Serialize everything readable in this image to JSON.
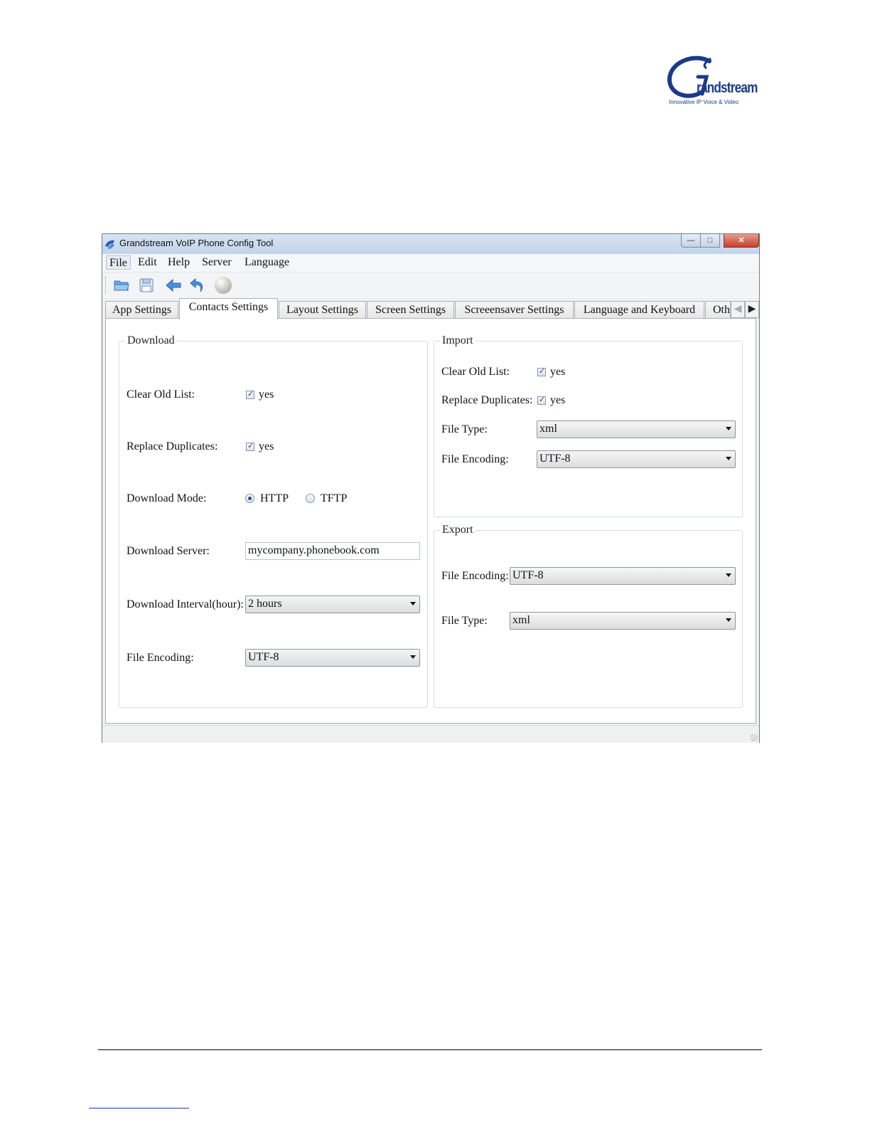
{
  "logo": {
    "brand": "Grandstream",
    "wordmark": "randstream",
    "tagline": "Innovative IP Voice & Video"
  },
  "window": {
    "title": "Grandstream VoIP Phone Config Tool",
    "controls": {
      "minimize": "—",
      "maximize": "□",
      "close": "✕"
    }
  },
  "menu": [
    "File",
    "Edit",
    "Help",
    "Server",
    "Language"
  ],
  "toolbar": [
    "open-folder-icon",
    "save-icon",
    "back-arrow-icon",
    "undo-arrow-icon",
    "sphere-icon"
  ],
  "tabs": [
    "App Settings",
    "Contacts Settings",
    "Layout Settings",
    "Screen Settings",
    "Screeensaver Settings",
    "Language and Keyboard",
    "Oth"
  ],
  "active_tab": "Contacts Settings",
  "download": {
    "legend": "Download",
    "clear_old_list": {
      "label": "Clear Old List:",
      "value": "yes",
      "checked": true
    },
    "replace_duplicates": {
      "label": "Replace Duplicates:",
      "value": "yes",
      "checked": true
    },
    "mode": {
      "label": "Download Mode:",
      "options": [
        "HTTP",
        "TFTP"
      ],
      "selected": "HTTP"
    },
    "server": {
      "label": "Download Server:",
      "value": "mycompany.phonebook.com"
    },
    "interval": {
      "label": "Download Interval(hour):",
      "value": "2 hours"
    },
    "encoding": {
      "label": "File Encoding:",
      "value": "UTF-8"
    }
  },
  "import": {
    "legend": "Import",
    "clear_old_list": {
      "label": "Clear Old List:",
      "value": "yes",
      "checked": true
    },
    "replace_duplicates": {
      "label": "Replace Duplicates:",
      "value": "yes",
      "checked": true
    },
    "file_type": {
      "label": "File Type:",
      "value": "xml"
    },
    "encoding": {
      "label": "File Encoding:",
      "value": "UTF-8"
    }
  },
  "export": {
    "legend": "Export",
    "encoding": {
      "label": "File Encoding:",
      "value": "UTF-8"
    },
    "file_type": {
      "label": "File Type:",
      "value": "xml"
    }
  },
  "colors": {
    "brand": "#1a3a8a",
    "titlebar": "#c2d4ea",
    "close_button": "#c8412a"
  }
}
